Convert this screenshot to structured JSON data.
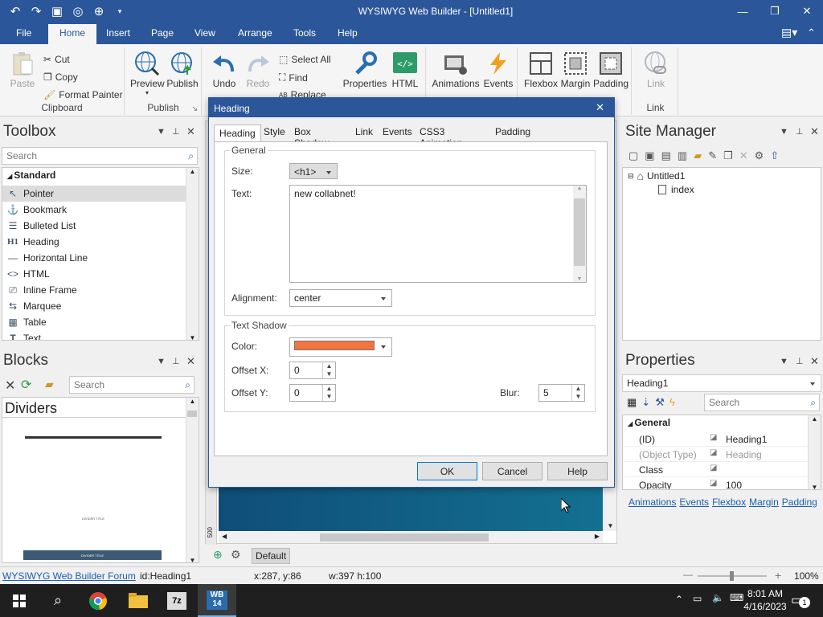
{
  "app": {
    "title": "WYSIWYG Web Builder - [Untitled1]"
  },
  "menu": {
    "tabs": [
      "File",
      "Home",
      "Insert",
      "Page",
      "View",
      "Arrange",
      "Tools",
      "Help"
    ]
  },
  "ribbon": {
    "paste": "Paste",
    "cut": "Cut",
    "copy": "Copy",
    "format_painter": "Format Painter",
    "clipboard": "Clipboard",
    "preview": "Preview",
    "publish": "Publish",
    "publish_group": "Publish",
    "undo": "Undo",
    "redo": "Redo",
    "select_all": "Select All",
    "find": "Find",
    "replace": "Replace",
    "properties": "Properties",
    "html": "HTML",
    "animations": "Animations",
    "events": "Events",
    "flexbox": "Flexbox",
    "margin": "Margin",
    "padding": "Padding",
    "link": "Link",
    "link_group": "Link"
  },
  "toolbox": {
    "title": "Toolbox",
    "search_placeholder": "Search",
    "section": "Standard",
    "items": [
      "Pointer",
      "Bookmark",
      "Bulleted List",
      "Heading",
      "Horizontal Line",
      "HTML",
      "Inline Frame",
      "Marquee",
      "Table",
      "Text"
    ]
  },
  "blocks": {
    "title": "Blocks",
    "search_placeholder": "Search",
    "category": "Dividers",
    "thumb_caption": "DIVIDER TITLE"
  },
  "site_manager": {
    "title": "Site Manager",
    "tree_root": "Untitled1",
    "tree_child": "index"
  },
  "properties": {
    "title": "Properties",
    "object": "Heading1",
    "search_placeholder": "Search",
    "section": "General",
    "rows": [
      {
        "name": "(ID)",
        "value": "Heading1"
      },
      {
        "name": "(Object Type)",
        "value": "Heading"
      },
      {
        "name": "Class",
        "value": ""
      },
      {
        "name": "Opacity",
        "value": "100"
      }
    ],
    "links": [
      "Animations",
      "Events",
      "Flexbox",
      "Margin",
      "Padding"
    ]
  },
  "dialog": {
    "title": "Heading",
    "tabs": [
      "Heading",
      "Style",
      "Box Shadow",
      "Link",
      "Events",
      "CSS3 Animation",
      "Padding"
    ],
    "general_legend": "General",
    "size_label": "Size:",
    "size_value": "<h1>",
    "text_label": "Text:",
    "text_value": "new collabnet!",
    "alignment_label": "Alignment:",
    "alignment_value": "center",
    "shadow_legend": "Text Shadow",
    "color_label": "Color:",
    "color_value": "#f4743f",
    "offset_x_label": "Offset X:",
    "offset_x_value": "0",
    "offset_y_label": "Offset Y:",
    "offset_y_value": "0",
    "blur_label": "Blur:",
    "blur_value": "5",
    "ok": "OK",
    "cancel": "Cancel",
    "help": "Help"
  },
  "canvas": {
    "ruler_mark": "500",
    "tab_default": "Default"
  },
  "status": {
    "forum": "WYSIWYG Web Builder Forum",
    "id": "id:Heading1",
    "coords": "x:287, y:86",
    "size": "w:397 h:100",
    "zoom": "100%"
  },
  "taskbar": {
    "time": "8:01 AM",
    "date": "4/16/2023",
    "notif": "1"
  },
  "colors": {
    "accent": "#2b579a",
    "canvas_bg": "#0f5a84"
  }
}
